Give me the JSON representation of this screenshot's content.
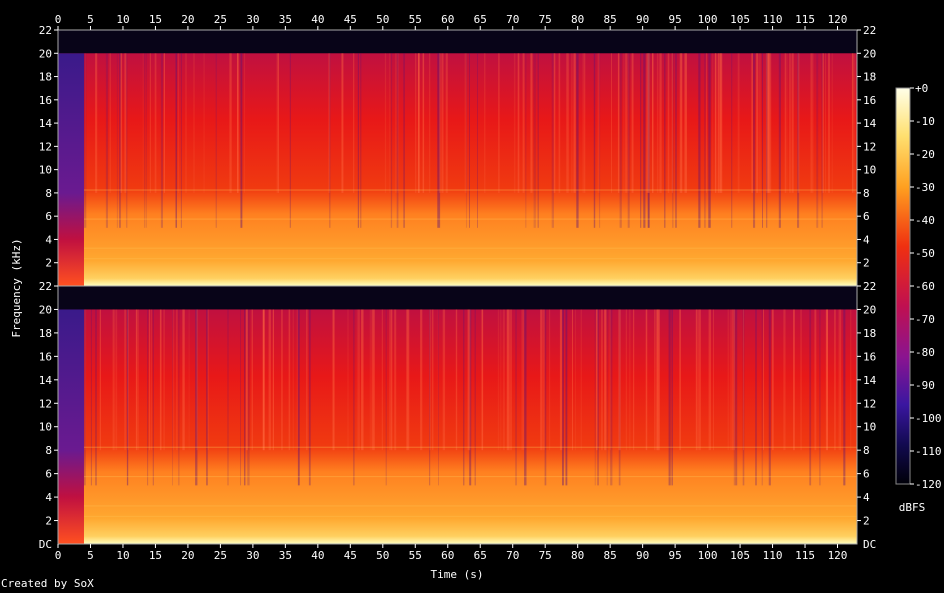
{
  "chart_data": {
    "type": "heatmap",
    "title": "",
    "xlabel": "Time (s)",
    "ylabel": "Frequency (kHz)",
    "colorbar_label": "dBFS",
    "duration_s": 123,
    "xlim": [
      0,
      123
    ],
    "ylim_khz": [
      0,
      22
    ],
    "channels": 2,
    "x_ticks": [
      0,
      5,
      10,
      15,
      20,
      25,
      30,
      35,
      40,
      45,
      50,
      55,
      60,
      65,
      70,
      75,
      80,
      85,
      90,
      95,
      100,
      105,
      110,
      115,
      120
    ],
    "y_ticks": [
      {
        "value": 22,
        "label": "22"
      },
      {
        "value": 20,
        "label": "20"
      },
      {
        "value": 18,
        "label": "18"
      },
      {
        "value": 16,
        "label": "16"
      },
      {
        "value": 14,
        "label": "14"
      },
      {
        "value": 12,
        "label": "12"
      },
      {
        "value": 10,
        "label": "10"
      },
      {
        "value": 8,
        "label": "8"
      },
      {
        "value": 6,
        "label": "6"
      },
      {
        "value": 4,
        "label": "4"
      },
      {
        "value": 2,
        "label": "2"
      }
    ],
    "bottom_label": "DC",
    "colorbar_ticks": [
      "+0",
      "-10",
      "-20",
      "-30",
      "-40",
      "-50",
      "-60",
      "-70",
      "-80",
      "-90",
      "-100",
      "-110",
      "-120"
    ],
    "colorbar_range_dbfs": [
      -120,
      0
    ],
    "colors": {
      "high": "#ffffe0",
      "orange": "#ffa020",
      "red": "#e81818",
      "magenta": "#a0107a",
      "purple": "#4a1aa0",
      "low": "#000010"
    },
    "content_cutoff_khz": 20,
    "silent_intro_s": [
      0,
      4
    ]
  },
  "footer": {
    "credit": "Created by SoX"
  }
}
